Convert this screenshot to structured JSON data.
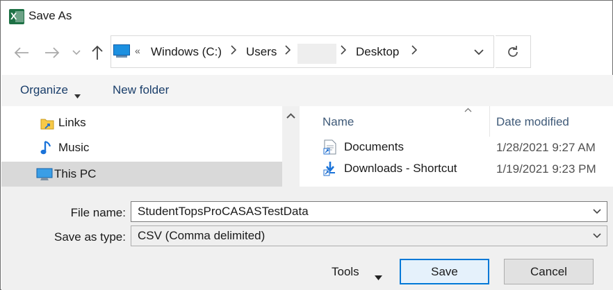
{
  "window": {
    "title": "Save As",
    "app_icon_letter": "X"
  },
  "address": {
    "more": "«",
    "crumbs": [
      "Windows (C:)",
      "Users",
      "Desktop"
    ]
  },
  "toolbar": {
    "organize": "Organize",
    "new_folder": "New folder"
  },
  "nav_pane": {
    "items": [
      "Links",
      "Music",
      "This PC"
    ]
  },
  "file_list": {
    "columns": {
      "name": "Name",
      "date": "Date modified"
    },
    "rows": [
      {
        "name": "Documents",
        "date": "1/28/2021 9:27 AM"
      },
      {
        "name": "Downloads - Shortcut",
        "date": "1/19/2021 9:23 PM"
      }
    ]
  },
  "form": {
    "file_name_label": "File name:",
    "file_name_value": "StudentTopsProCASASTestData",
    "save_type_label": "Save as type:",
    "save_type_value": "CSV (Comma delimited)"
  },
  "buttons": {
    "tools": "Tools",
    "save": "Save",
    "cancel": "Cancel"
  },
  "colors": {
    "accent": "#0078d7",
    "excel": "#1e7145",
    "selection": "#d9d9d9"
  }
}
